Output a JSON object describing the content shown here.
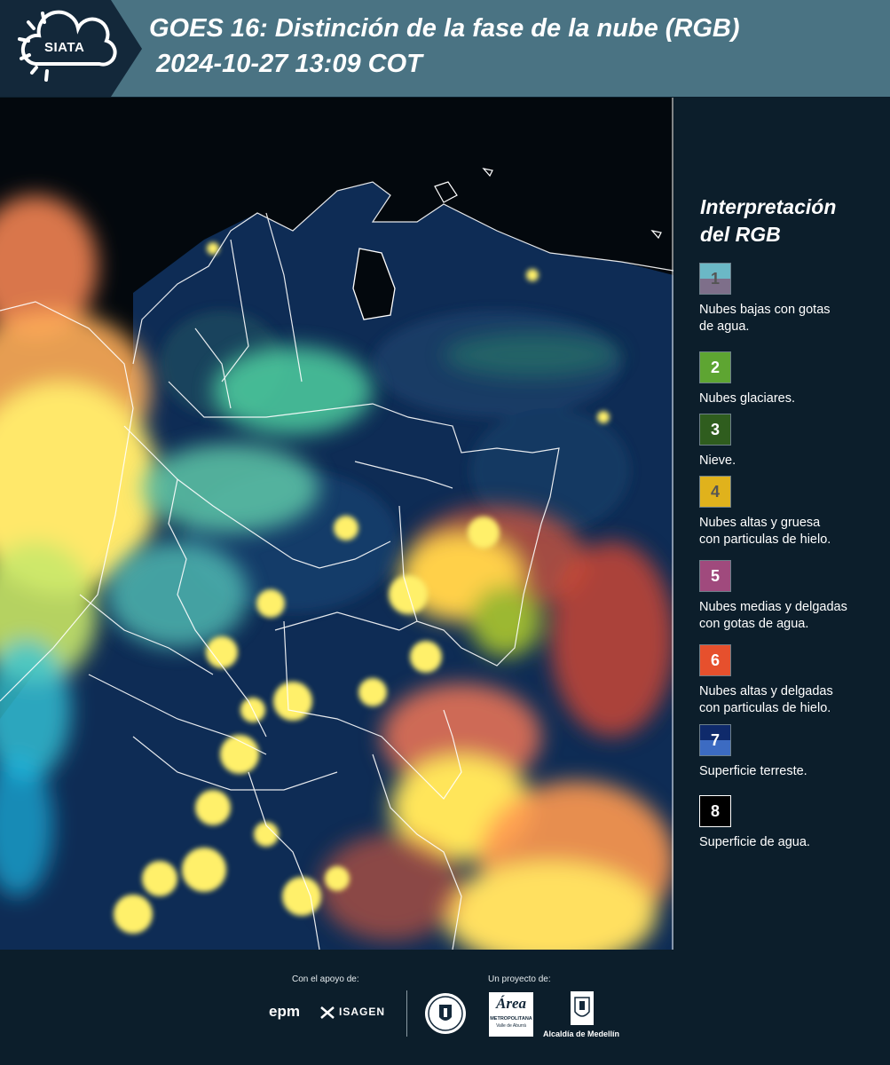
{
  "header": {
    "logo": "SIATA",
    "title_line1": "GOES 16: Distinción de la fase de la nube (RGB)",
    "title_line2": "2024-10-27 13:09 COT"
  },
  "legend": {
    "title_line1": "Interpretación",
    "title_line2": "del RGB",
    "items": [
      {
        "number": "1",
        "label_line1": "Nubes bajas con gotas",
        "label_line2": "de agua.",
        "color_top": "#6bb8c6",
        "color_bottom": "#7e6f8a",
        "number_color": "#555555"
      },
      {
        "number": "2",
        "label_line1": "Nubes glaciares.",
        "label_line2": "",
        "color_top": "#5ea532",
        "color_bottom": "#5ea532",
        "number_color": "#ffffff"
      },
      {
        "number": "3",
        "label_line1": "Nieve.",
        "label_line2": "",
        "color_top": "#2f5d1e",
        "color_bottom": "#2f5d1e",
        "number_color": "#ffffff"
      },
      {
        "number": "4",
        "label_line1": "Nubes altas y gruesa",
        "label_line2": "con particulas de hielo.",
        "color_top": "#e0b21c",
        "color_bottom": "#e0b21c",
        "number_color": "#555555"
      },
      {
        "number": "5",
        "label_line1": "Nubes medias y delgadas",
        "label_line2": "con gotas de agua.",
        "color_top": "#a04a7d",
        "color_bottom": "#a04a7d",
        "number_color": "#ffffff"
      },
      {
        "number": "6",
        "label_line1": "Nubes altas y delgadas",
        "label_line2": "con particulas de hielo.",
        "color_top": "#e6502d",
        "color_bottom": "#e6502d",
        "number_color": "#ffffff"
      },
      {
        "number": "7",
        "label_line1": "Superficie terreste.",
        "label_line2": "",
        "color_top": "#0f2a6b",
        "color_bottom": "#3c6bc2",
        "number_color": "#ffffff"
      },
      {
        "number": "8",
        "label_line1": "Superficie de agua.",
        "label_line2": "",
        "color_top": "#000000",
        "color_bottom": "#000000",
        "number_color": "#ffffff"
      }
    ]
  },
  "footer": {
    "support_text": "Con el apoyo de:",
    "project_text": "Un proyecto de:",
    "epm": "epm",
    "isagen": "ISAGEN",
    "area_line1": "Área",
    "area_line2": "METROPOLITANA",
    "area_line3": "Valle de Aburrá",
    "alcaldia": "Alcaldía de Medellín"
  },
  "colors": {
    "header_bg": "#4a7383",
    "legend_bg": "#0c1e2b",
    "ocean": "#03080d",
    "land": "#0e2c55"
  },
  "icons": [
    "siata-logo-icon",
    "medellin-seal-icon",
    "area-metropolitana-logo-icon",
    "alcaldia-shield-icon",
    "isagen-icon"
  ]
}
